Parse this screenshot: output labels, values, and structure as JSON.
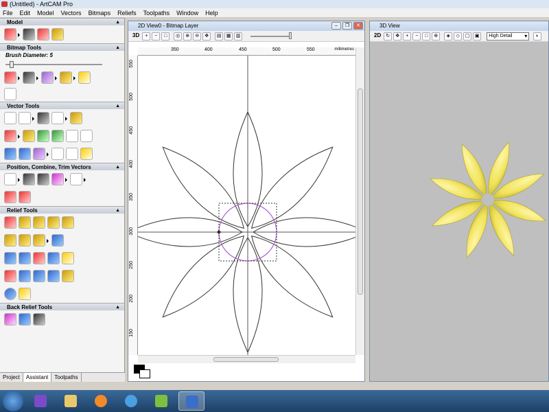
{
  "app": {
    "title": "(Untitled) - ArtCAM Pro"
  },
  "menu": [
    "File",
    "Edit",
    "Model",
    "Vectors",
    "Bitmaps",
    "Reliefs",
    "Toolpaths",
    "Window",
    "Help"
  ],
  "panel": {
    "sections": {
      "model": "Model",
      "bitmap": "Bitmap Tools",
      "vector": "Vector Tools",
      "position": "Position, Combine, Trim Vectors",
      "relief": "Relief Tools",
      "back_relief": "Back Relief Tools"
    },
    "brush_label": "Brush Diameter:",
    "brush_value": "5",
    "tabs": [
      "Project",
      "Assistant",
      "Toolpaths"
    ]
  },
  "view2d": {
    "title": "2D View0 - Bitmap Layer",
    "toolbar_label": "3D",
    "units": "millimetres",
    "xticks": [
      "350",
      "400",
      "450",
      "500",
      "550"
    ],
    "yticks": [
      "550",
      "500",
      "450",
      "400",
      "350",
      "300",
      "250",
      "200",
      "150"
    ]
  },
  "view3d": {
    "title": "3D View",
    "toolbar_label": "2D",
    "detail": "High Detail"
  },
  "colors": {
    "petal": "#f1e35a",
    "circle": "#b15ccf",
    "panel_header": "#c7ccd6",
    "taskbar": "#1d4066"
  }
}
